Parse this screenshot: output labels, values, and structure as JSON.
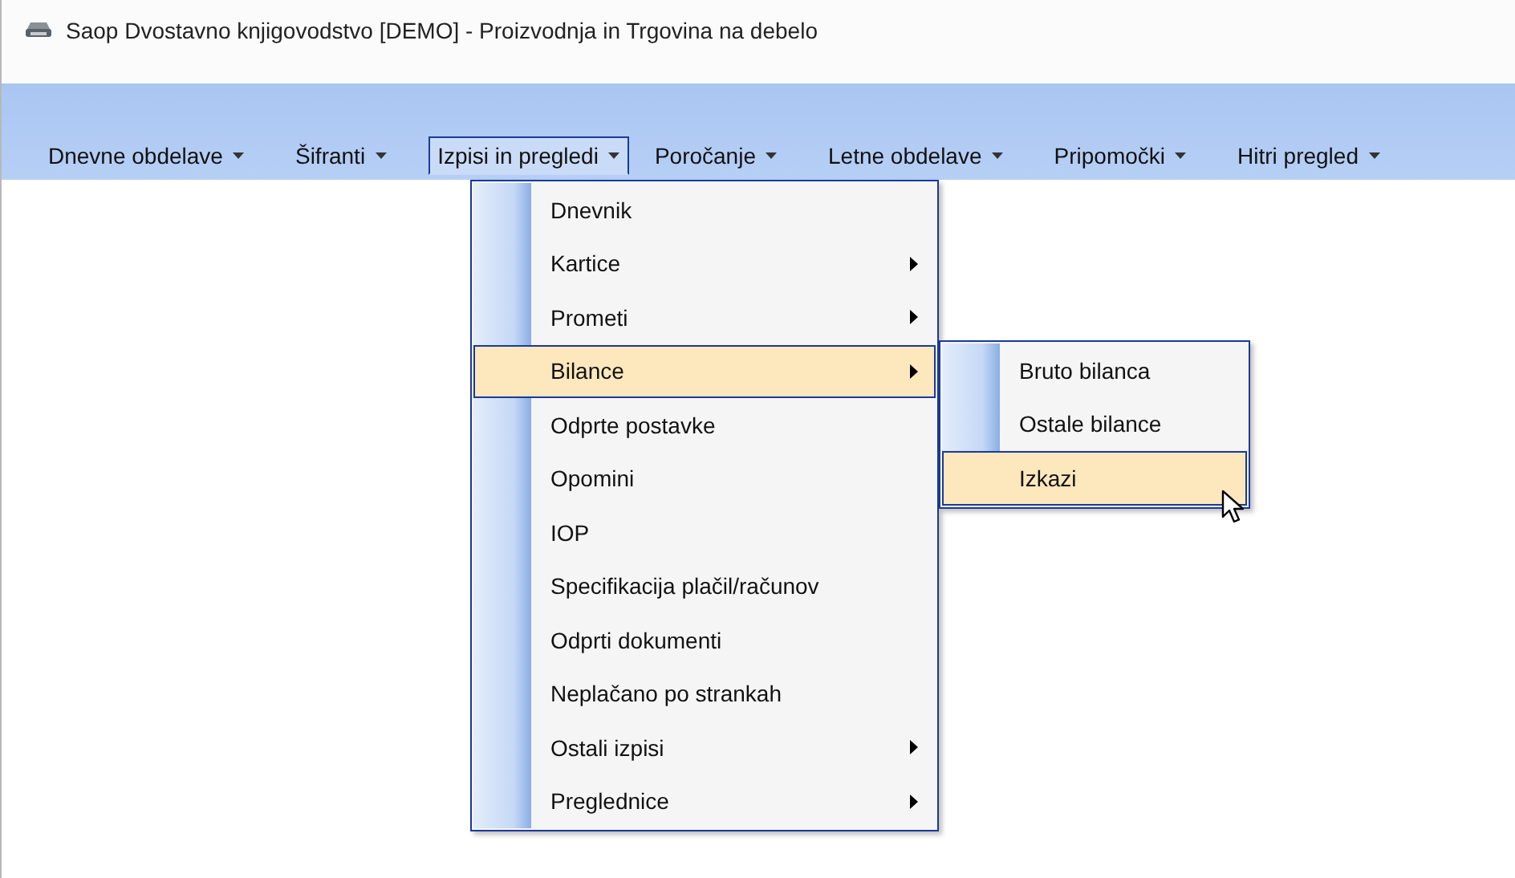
{
  "window": {
    "title": "Saop Dvostavno knjigovodstvo [DEMO] - Proizvodnja in Trgovina na debelo"
  },
  "menubar": [
    {
      "label": "Dnevne obdelave",
      "selected": false
    },
    {
      "label": "Šifranti",
      "selected": false
    },
    {
      "label": "Izpisi in pregledi",
      "selected": true
    },
    {
      "label": "Poročanje",
      "selected": false
    },
    {
      "label": "Letne obdelave",
      "selected": false
    },
    {
      "label": "Pripomočki",
      "selected": false
    },
    {
      "label": "Hitri pregled",
      "selected": false
    }
  ],
  "menu": [
    {
      "label": "Dnevnik",
      "submenu": false,
      "selected": false
    },
    {
      "label": "Kartice",
      "submenu": true,
      "selected": false
    },
    {
      "label": "Prometi",
      "submenu": true,
      "selected": false
    },
    {
      "label": "Bilance",
      "submenu": true,
      "selected": true
    },
    {
      "label": "Odprte postavke",
      "submenu": false,
      "selected": false
    },
    {
      "label": "Opomini",
      "submenu": false,
      "selected": false
    },
    {
      "label": "IOP",
      "submenu": false,
      "selected": false
    },
    {
      "label": "Specifikacija plačil/računov",
      "submenu": false,
      "selected": false
    },
    {
      "label": "Odprti dokumenti",
      "submenu": false,
      "selected": false
    },
    {
      "label": "Neplačano po strankah",
      "submenu": false,
      "selected": false
    },
    {
      "label": "Ostali izpisi",
      "submenu": true,
      "selected": false
    },
    {
      "label": "Preglednice",
      "submenu": true,
      "selected": false
    }
  ],
  "submenu": [
    {
      "label": "Bruto bilanca",
      "selected": false
    },
    {
      "label": "Ostale bilance",
      "selected": false
    },
    {
      "label": "Izkazi",
      "selected": true
    }
  ]
}
